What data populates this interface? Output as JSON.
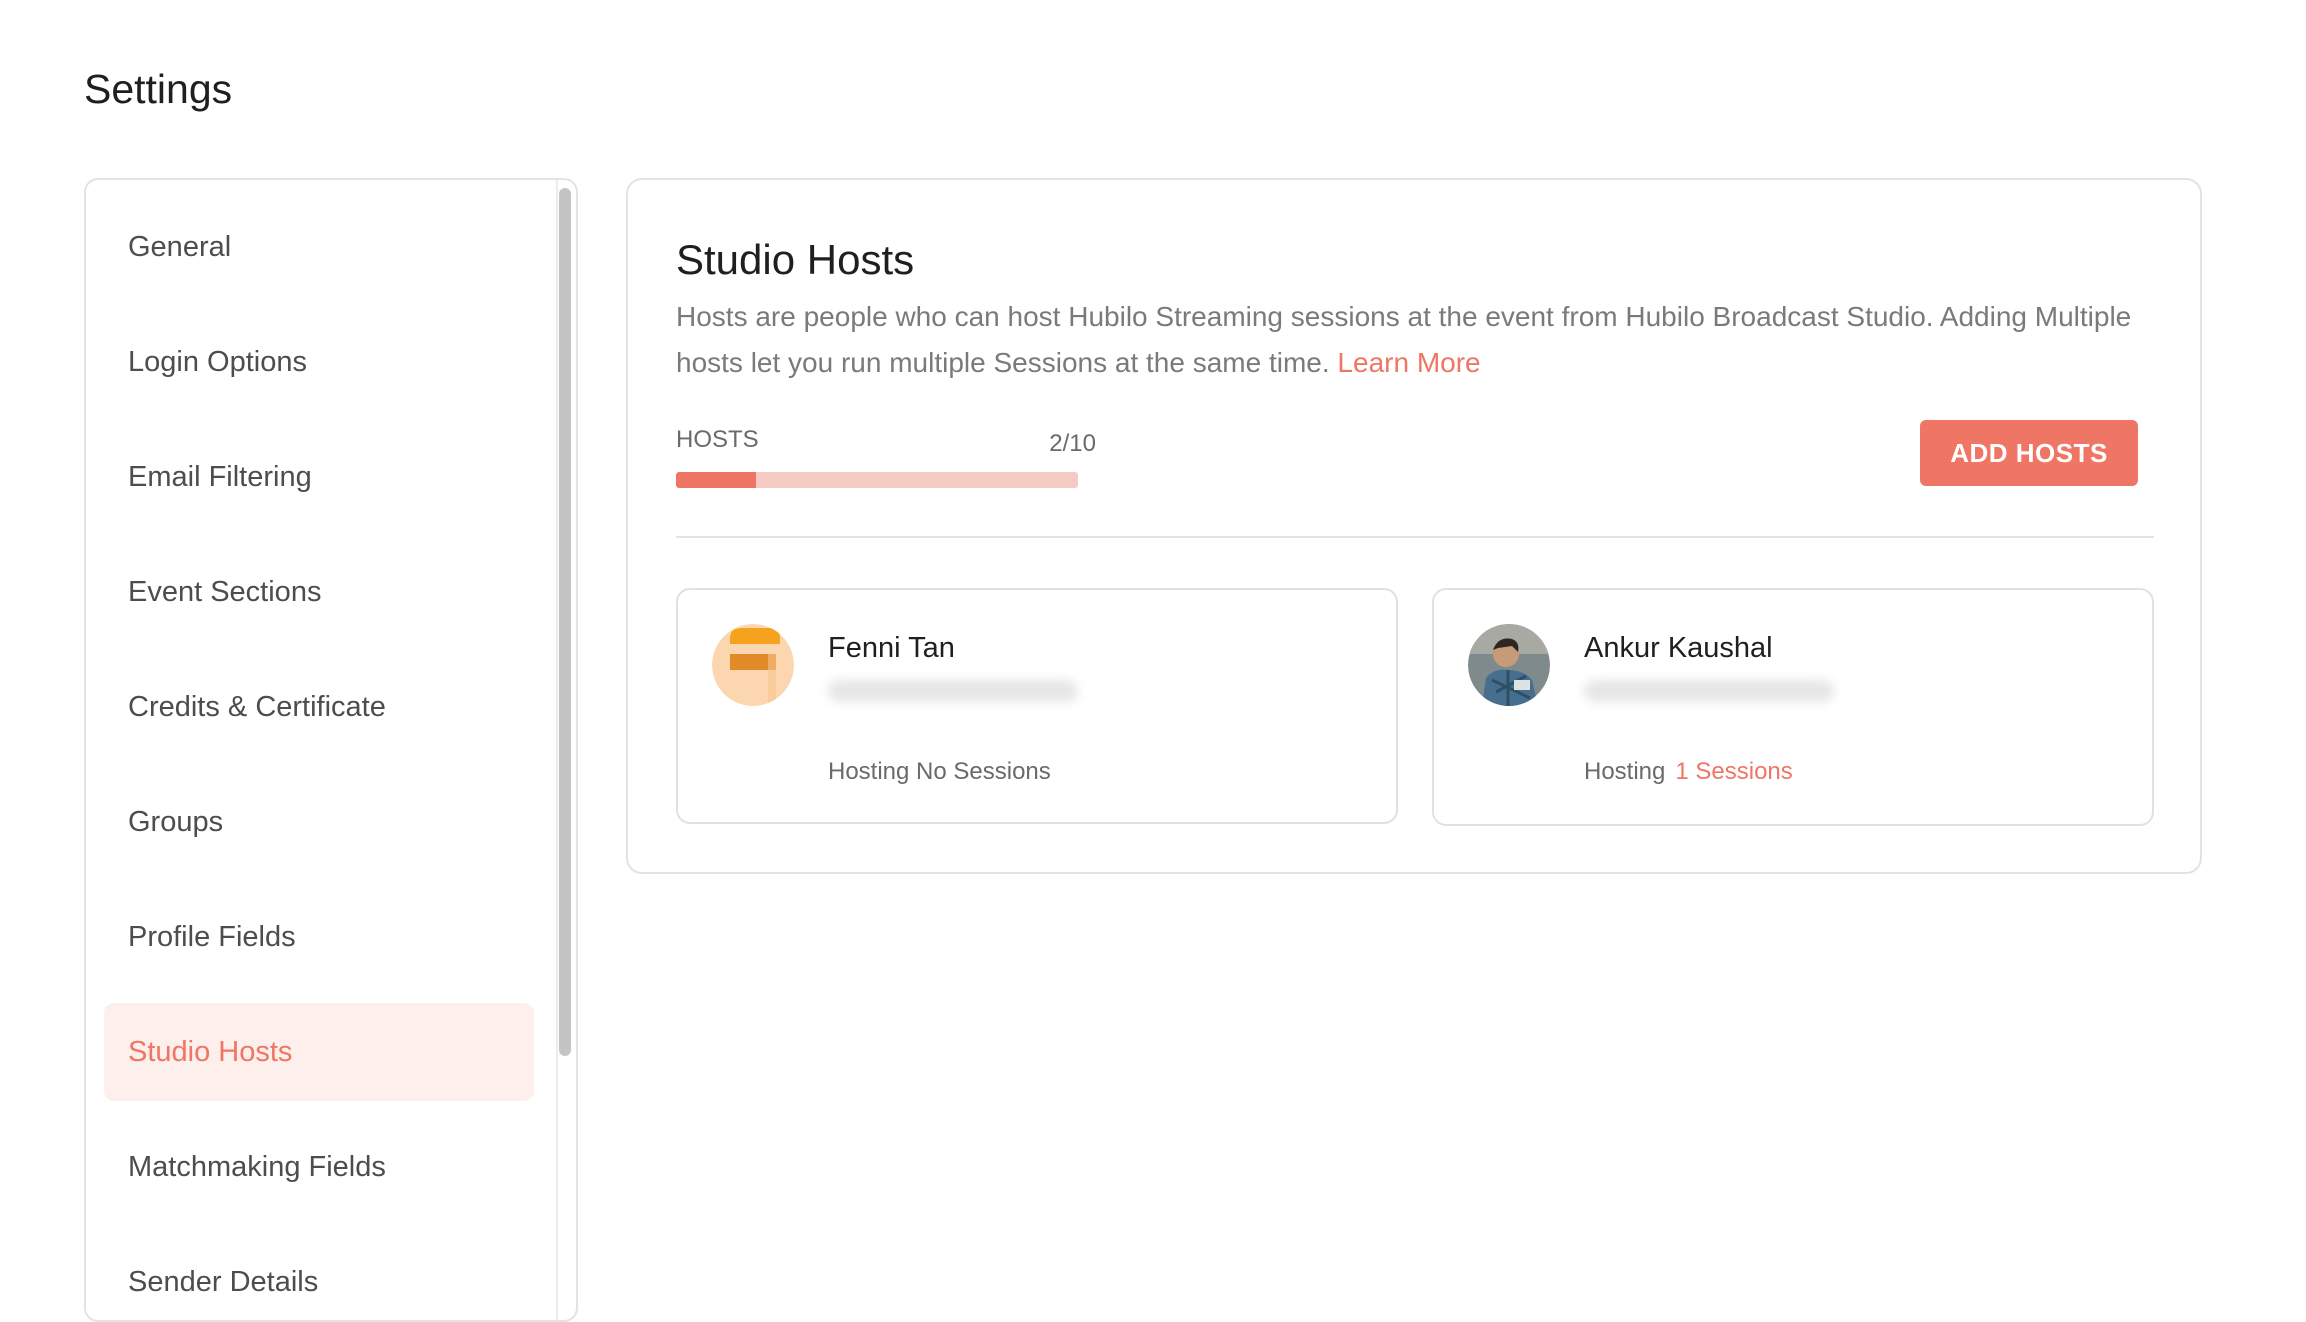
{
  "page": {
    "title": "Settings"
  },
  "sidebar": {
    "items": [
      {
        "label": "General"
      },
      {
        "label": "Login Options"
      },
      {
        "label": "Email Filtering"
      },
      {
        "label": "Event Sections"
      },
      {
        "label": "Credits & Certificate"
      },
      {
        "label": "Groups"
      },
      {
        "label": "Profile Fields"
      },
      {
        "label": "Studio Hosts",
        "active": true
      },
      {
        "label": "Matchmaking Fields"
      },
      {
        "label": "Sender Details"
      }
    ]
  },
  "studio_hosts": {
    "title": "Studio Hosts",
    "description": "Hosts are people who can host Hubilo Streaming sessions at the event from Hubilo Broadcast Studio. Adding Multiple hosts let you run multiple Sessions at the same time.",
    "learn_more": "Learn More",
    "hosts_label": "HOSTS",
    "hosts_count": "2/10",
    "hosts_used": 2,
    "hosts_max": 10,
    "add_button": "ADD HOSTS",
    "hosts": [
      {
        "name": "Fenni Tan",
        "status": "Hosting No Sessions",
        "sessions": ""
      },
      {
        "name": "Ankur Kaushal",
        "status": "Hosting",
        "sessions": "1 Sessions"
      }
    ]
  },
  "colors": {
    "accent": "#ef7564",
    "accent_light": "#fdefec",
    "progress_track": "#f6cbc4"
  }
}
